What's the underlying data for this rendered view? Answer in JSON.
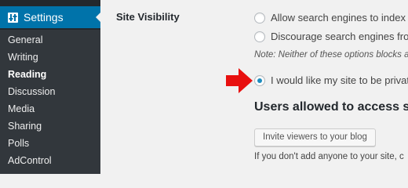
{
  "sidebar": {
    "header_label": "Settings",
    "items": [
      {
        "label": "General"
      },
      {
        "label": "Writing"
      },
      {
        "label": "Reading"
      },
      {
        "label": "Discussion"
      },
      {
        "label": "Media"
      },
      {
        "label": "Sharing"
      },
      {
        "label": "Polls"
      },
      {
        "label": "AdControl"
      }
    ],
    "current": "Reading"
  },
  "main": {
    "section_label": "Site Visibility",
    "options": [
      {
        "label": "Allow search engines to index this",
        "checked": false
      },
      {
        "label": "Discourage search engines from in",
        "checked": false
      },
      {
        "label": "I would like my site to be private, v",
        "checked": true
      }
    ],
    "note": "Note: Neither of these options blocks ac",
    "users_heading": "Users allowed to access site",
    "invite_button": "Invite viewers to your blog",
    "help_text": "If you don't add anyone to your site, c"
  },
  "colors": {
    "sidebar_bg": "#23282d",
    "submenu_bg": "#32373c",
    "accent": "#0073aa",
    "radio_checked": "#1e8cbe",
    "arrow": "#e8100f"
  }
}
